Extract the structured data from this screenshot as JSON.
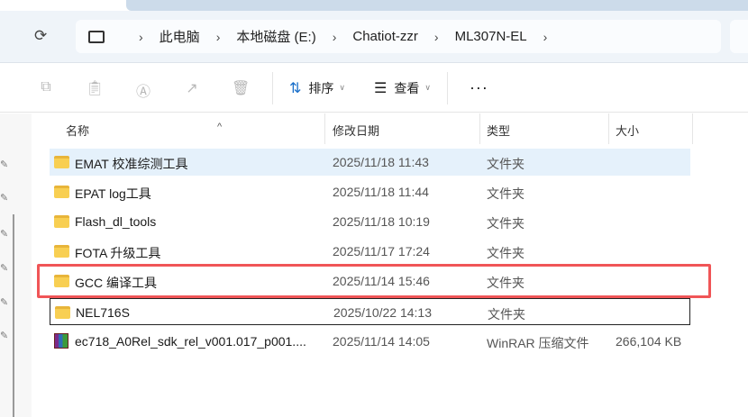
{
  "breadcrumb": [
    "此电脑",
    "本地磁盘 (E:)",
    "Chatiot-zzr",
    "ML307N-EL"
  ],
  "toolbar": {
    "sort_label": "排序",
    "view_label": "查看",
    "more_label": "···"
  },
  "columns": {
    "name": "名称",
    "date": "修改日期",
    "type": "类型",
    "size": "大小"
  },
  "files": [
    {
      "name": "EMAT 校准综测工具",
      "date": "2025/11/18 11:43",
      "type": "文件夹",
      "size": ""
    },
    {
      "name": "EPAT log工具",
      "date": "2025/11/18 11:44",
      "type": "文件夹",
      "size": ""
    },
    {
      "name": "Flash_dl_tools",
      "date": "2025/11/18 10:19",
      "type": "文件夹",
      "size": ""
    },
    {
      "name": "FOTA 升级工具",
      "date": "2025/11/17 17:24",
      "type": "文件夹",
      "size": ""
    },
    {
      "name": "GCC 编译工具",
      "date": "2025/11/14 15:46",
      "type": "文件夹",
      "size": ""
    },
    {
      "name": "NEL716S",
      "date": "2025/10/22 14:13",
      "type": "文件夹",
      "size": ""
    },
    {
      "name": "ec718_A0Rel_sdk_rel_v001.017_p001....",
      "date": "2025/11/14 14:05",
      "type": "WinRAR 压缩文件",
      "size": "266,104 KB"
    }
  ],
  "colors": {
    "highlight": "#f05557",
    "hover": "#e5f1fb"
  }
}
